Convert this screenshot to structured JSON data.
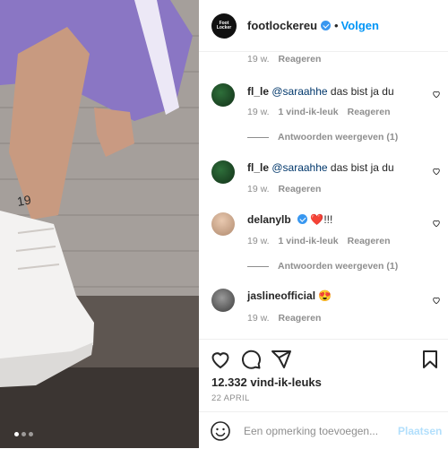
{
  "post": {
    "username": "footlockereu",
    "follow_label": "Volgen",
    "separator": "•",
    "avatar_text": "Foot Locker",
    "likes": "12.332 vind-ik-leuks",
    "date": "22 APRIL"
  },
  "comments": {
    "top_meta": {
      "time": "19 w.",
      "reply": "Reageren"
    },
    "items": [
      {
        "username": "fl_le",
        "mention": "@saraahhe",
        "text": " das bist ja du",
        "time": "19 w.",
        "likes": "1 vind-ik-leuk",
        "reply": "Reageren",
        "view_replies": "Antwoorden weergeven (1)"
      },
      {
        "username": "fl_le",
        "mention": "@saraahhe",
        "text": " das bist ja du",
        "time": "19 w.",
        "reply": "Reageren"
      },
      {
        "username": "delanylb",
        "text": "❤️!!!",
        "time": "19 w.",
        "likes": "1 vind-ik-leuk",
        "reply": "Reageren",
        "view_replies": "Antwoorden weergeven (1)"
      },
      {
        "username": "jaslineofficial",
        "text": "😍",
        "time": "19 w.",
        "reply": "Reageren"
      }
    ]
  },
  "composer": {
    "placeholder": "Een opmerking toevoegen...",
    "post_label": "Plaatsen"
  },
  "carousel": {
    "slides": 3,
    "active": 1
  },
  "colors": {
    "accent": "#0095f6",
    "verified": "#3897f0",
    "heart": "#ed4956"
  },
  "icons": [
    "heart-icon",
    "comment-icon",
    "share-icon",
    "bookmark-icon",
    "emoji-icon",
    "verified-icon"
  ]
}
